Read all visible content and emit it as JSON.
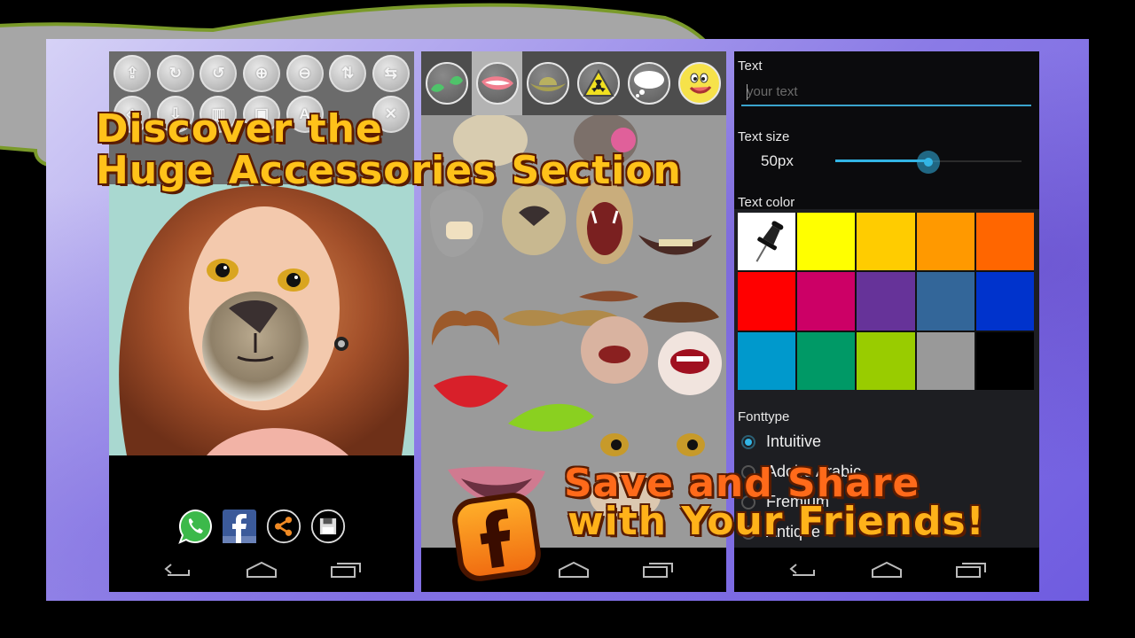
{
  "promo": {
    "headline_line1": "Discover the",
    "headline_line2": "Huge Accessories Section",
    "footer_line1": "Save and Share",
    "footer_line2": "with Your Friends!"
  },
  "editor_screen": {
    "toolbar_icons": [
      "import-photo-icon",
      "rotate-right-icon",
      "rotate-left-icon",
      "zoom-in-icon",
      "zoom-out-icon",
      "flip-vertical-icon",
      "flip-horizontal-icon",
      "diamond-icon",
      "move-down-icon",
      "frame-icon",
      "crop-icon",
      "text-icon",
      "",
      "delete-icon"
    ],
    "toolbar_glyphs": [
      "⇪",
      "↻",
      "↺",
      "⊕",
      "⊖",
      "⇅",
      "⇆",
      "◇",
      "⇩",
      "▥",
      "▣",
      "A",
      "",
      "✕"
    ],
    "share_buttons": [
      "whatsapp",
      "facebook",
      "share",
      "save"
    ]
  },
  "accessories_screen": {
    "category_tabs": [
      {
        "name": "eyes",
        "selected": false
      },
      {
        "name": "mouths",
        "selected": true
      },
      {
        "name": "hats",
        "selected": false
      },
      {
        "name": "signs",
        "selected": false
      },
      {
        "name": "speech-bubbles",
        "selected": false
      },
      {
        "name": "emoticons",
        "selected": false
      }
    ]
  },
  "text_screen": {
    "text_label": "Text",
    "text_placeholder": "your text",
    "text_value": "",
    "size_label": "Text size",
    "size_value": "50px",
    "size_slider_fraction": 0.5,
    "color_label": "Text color",
    "colors": [
      "#ffffff",
      "#ffff00",
      "#ffcc00",
      "#ff9900",
      "#ff6600",
      "#ff0000",
      "#cc0066",
      "#663399",
      "#336699",
      "#0033cc",
      "#0099cc",
      "#009966",
      "#99cc00",
      "#999999",
      "#000000"
    ],
    "fonttype_label": "Fonttype",
    "font_options": [
      {
        "label": "Intuitive",
        "checked": true
      },
      {
        "label": "Adobe Arabic",
        "checked": false
      },
      {
        "label": "Fremium",
        "checked": false
      },
      {
        "label": "Antique",
        "checked": false
      }
    ]
  }
}
